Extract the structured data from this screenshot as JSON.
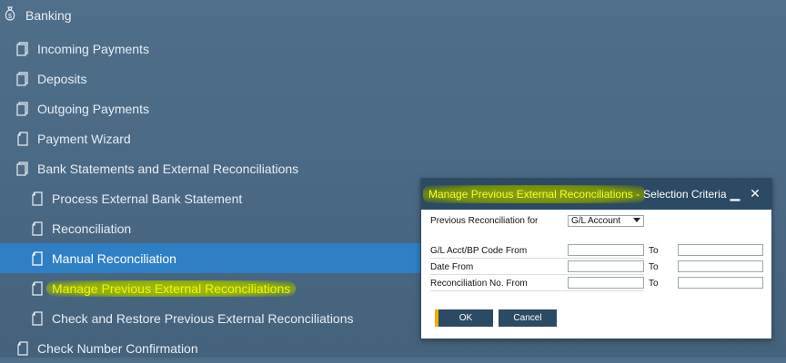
{
  "menu": {
    "banking": "Banking",
    "items": [
      {
        "label": "Incoming Payments"
      },
      {
        "label": "Deposits"
      },
      {
        "label": "Outgoing Payments"
      },
      {
        "label": "Payment Wizard"
      },
      {
        "label": "Bank Statements and External Reconciliations"
      },
      {
        "label": "Process External Bank Statement"
      },
      {
        "label": "Reconciliation"
      },
      {
        "label": "Manual Reconciliation"
      },
      {
        "label": "Manage Previous External Reconciliations"
      },
      {
        "label": "Check and Restore Previous External Reconciliations"
      },
      {
        "label": "Check Number Confirmation"
      }
    ]
  },
  "dialog": {
    "title_highlight": "Manage Previous External Reconciliations -",
    "title_rest": " Selection Criteria",
    "minimize": "▁",
    "close": "✕",
    "recon_for_label": "Previous Reconciliation for",
    "recon_for_value": "G/L Account",
    "code_from_label": "G/L Acct/BP Code From",
    "date_from_label": "Date From",
    "recon_no_label": "Reconciliation No. From",
    "to_label": "To",
    "ok": "OK",
    "cancel": "Cancel"
  },
  "colors": {
    "background": "#4b6a86",
    "selected_row": "#2f7fc4",
    "highlight_text": "#f5f700",
    "dialog_header": "#2c4a63",
    "ok_accent": "#f0b000"
  },
  "icons": {
    "banking": "money-bag-icon",
    "folder": "folder-pages-icon",
    "document": "document-icon"
  }
}
